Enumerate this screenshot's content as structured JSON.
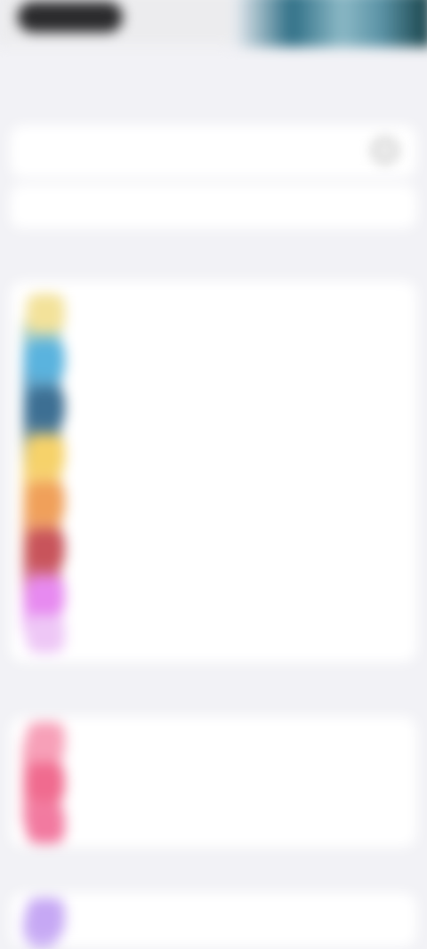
{
  "header": {
    "title": ""
  },
  "search": {
    "placeholder": ""
  },
  "segments": [
    {
      "label": ""
    },
    {
      "label": ""
    }
  ],
  "sections": [
    {
      "header": "",
      "rows": [
        {
          "title": "",
          "subtitle": "",
          "color": "#f3e29a"
        },
        {
          "title": "",
          "subtitle": "",
          "color": "#5ab3de"
        },
        {
          "title": "",
          "subtitle": "",
          "color": "#3d6f93"
        },
        {
          "title": "",
          "subtitle": "",
          "color": "#f6d26a"
        },
        {
          "title": "",
          "subtitle": "",
          "color": "#f0a05a"
        },
        {
          "title": "",
          "subtitle": "",
          "color": "#c8545b"
        },
        {
          "title": "",
          "subtitle": "",
          "color": "#e78af0"
        },
        {
          "title": "",
          "subtitle": "",
          "color": "#eec7f6"
        }
      ]
    },
    {
      "header": "",
      "rows": [
        {
          "title": "",
          "color": "#f7a0b8"
        },
        {
          "title": "",
          "color": "#f06b8f"
        },
        {
          "title": "",
          "color": "#f27aa0"
        }
      ]
    },
    {
      "header": "",
      "rows": [
        {
          "title": "",
          "color": "#c6a8f4"
        }
      ]
    }
  ]
}
